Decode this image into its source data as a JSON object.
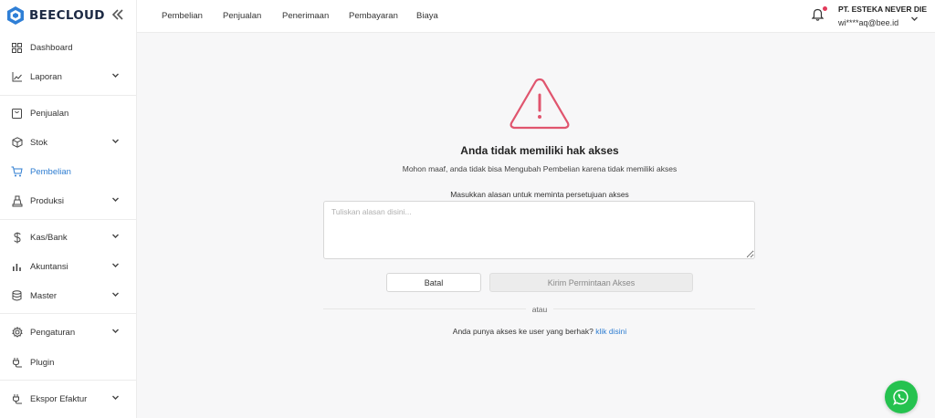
{
  "brand": {
    "name": "BEECLOUD",
    "accent": "#2e7dd1",
    "logo_color": "#2f7fd6"
  },
  "sidebar": {
    "items": [
      {
        "label": "Dashboard",
        "icon": "grid-icon",
        "has_chevron": false
      },
      {
        "label": "Laporan",
        "icon": "chart-line-icon",
        "has_chevron": true
      },
      {
        "label": "Penjualan",
        "icon": "bag-icon",
        "has_chevron": false
      },
      {
        "label": "Stok",
        "icon": "box-icon",
        "has_chevron": true
      },
      {
        "label": "Pembelian",
        "icon": "cart-icon",
        "has_chevron": false,
        "active": true
      },
      {
        "label": "Produksi",
        "icon": "factory-icon",
        "has_chevron": true
      },
      {
        "label": "Kas/Bank",
        "icon": "dollar-icon",
        "has_chevron": true
      },
      {
        "label": "Akuntansi",
        "icon": "bar-chart-icon",
        "has_chevron": true
      },
      {
        "label": "Master",
        "icon": "database-icon",
        "has_chevron": true
      },
      {
        "label": "Pengaturan",
        "icon": "gear-icon",
        "has_chevron": true
      },
      {
        "label": "Plugin",
        "icon": "plug-icon",
        "has_chevron": false
      },
      {
        "label": "Ekspor Efaktur",
        "icon": "export-icon",
        "has_chevron": true
      }
    ]
  },
  "topbar": {
    "menus": [
      "Pembelian",
      "Penjualan",
      "Penerimaan",
      "Pembayaran",
      "Biaya"
    ],
    "company": "PT. ESTEKA NEVER DIE",
    "email": "wi****aq@bee.id",
    "notification_dot_color": "#e23b5b"
  },
  "access": {
    "title": "Anda tidak memiliki hak akses",
    "subtitle": "Mohon maaf, anda tidak bisa Mengubah Pembelian karena tidak memiliki akses",
    "reason_label": "Masukkan alasan untuk meminta persetujuan akses",
    "reason_placeholder": "Tuliskan alasan disini...",
    "cancel_label": "Batal",
    "send_label": "Kirim Permintaan Akses",
    "or_label": "atau",
    "footer_text": "Anda punya akses ke user yang berhak?",
    "footer_link": "klik disini",
    "warning_color": "#e0556e"
  },
  "whatsapp": {
    "icon": "whatsapp-icon",
    "color": "#25c24f"
  }
}
